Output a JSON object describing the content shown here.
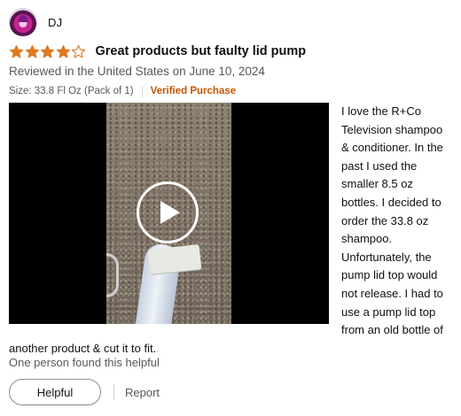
{
  "profile": {
    "name": "DJ",
    "avatar_icon": "avatar-purple-pink"
  },
  "review": {
    "rating": 4,
    "rating_max": 5,
    "star_color": "#de7921",
    "title": "Great products but faulty lid pump",
    "date_line": "Reviewed in the United States on June 10, 2024",
    "size": "Size: 33.8 Fl Oz (Pack of 1)",
    "verified": "Verified Purchase",
    "body": "I love the R+Co Television shampoo & conditioner. In the past I used the smaller 8.5 oz bottles. I decided to order the 33.8 oz shampoo. Unfortunately, the pump lid top would not release. I had to use a pump lid top from an old bottle of another product & cut it to fit.",
    "video": {
      "play_icon": "play-icon"
    }
  },
  "feedback": {
    "helpful_count": "One person found this helpful",
    "helpful_label": "Helpful",
    "report_label": "Report"
  }
}
